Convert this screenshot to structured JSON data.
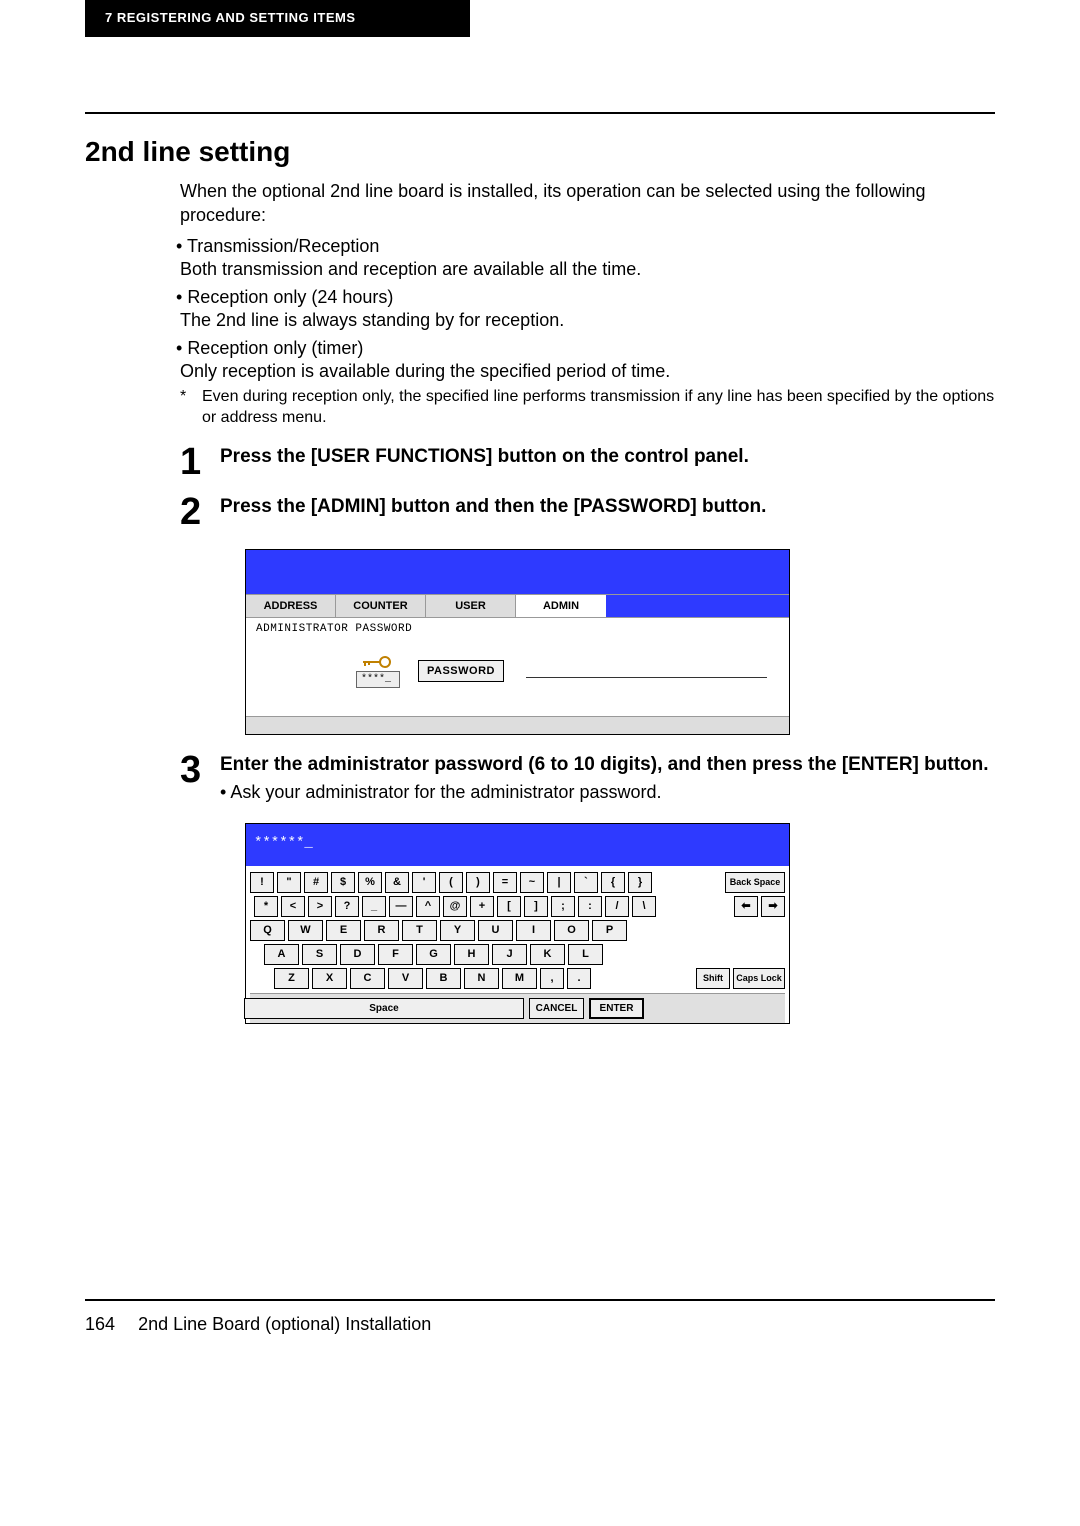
{
  "header": {
    "tab": "7  REGISTERING AND SETTING ITEMS"
  },
  "section": {
    "title": "2nd line setting",
    "intro": "When the optional 2nd line board is installed, its operation can be selected using the following procedure:",
    "bullets": [
      {
        "head": "Transmission/Reception",
        "body": "Both transmission and reception are available all the time."
      },
      {
        "head": "Reception only (24 hours)",
        "body": "The 2nd line is always standing by for reception."
      },
      {
        "head": "Reception only (timer)",
        "body": "Only reception is available during the specified period of time."
      }
    ],
    "star_note": "Even during reception only, the specified line performs transmission if any line has been specified by the options or address menu."
  },
  "steps": {
    "s1": "Press the [USER FUNCTIONS] button on the control panel.",
    "s2": "Press the [ADMIN] button and then the [PASSWORD] button.",
    "s3": "Enter the administrator password (6 to 10 digits), and then press the [ENTER] button.",
    "s3_sub": "Ask your administrator for the administrator password."
  },
  "ui1": {
    "tabs": [
      "ADDRESS",
      "COUNTER",
      "USER",
      "ADMIN"
    ],
    "body_label": "ADMINISTRATOR PASSWORD",
    "key_val": "****_",
    "password_btn": "PASSWORD"
  },
  "kb": {
    "display": "******_",
    "row1": [
      "!",
      "\"",
      "#",
      "$",
      "%",
      "&",
      "'",
      "(",
      ")",
      "=",
      "~",
      "|",
      "`",
      "{",
      "}"
    ],
    "row1_end": "Back Space",
    "row2": [
      "*",
      "<",
      ">",
      "?",
      "_",
      "—",
      "^",
      "@",
      "+",
      "[",
      "]",
      ";",
      ":",
      "/",
      "\\"
    ],
    "row2_arrows": [
      "⬅",
      "➡"
    ],
    "row3": [
      "Q",
      "W",
      "E",
      "R",
      "T",
      "Y",
      "U",
      "I",
      "O",
      "P"
    ],
    "row4": [
      "A",
      "S",
      "D",
      "F",
      "G",
      "H",
      "J",
      "K",
      "L"
    ],
    "row5": [
      "Z",
      "X",
      "C",
      "V",
      "B",
      "N",
      "M",
      ",",
      "."
    ],
    "row5_end": [
      "Shift",
      "Caps Lock"
    ],
    "bottom": {
      "space": "Space",
      "cancel": "CANCEL",
      "enter": "ENTER"
    }
  },
  "footer": {
    "page": "164",
    "title": "2nd Line Board (optional) Installation"
  }
}
